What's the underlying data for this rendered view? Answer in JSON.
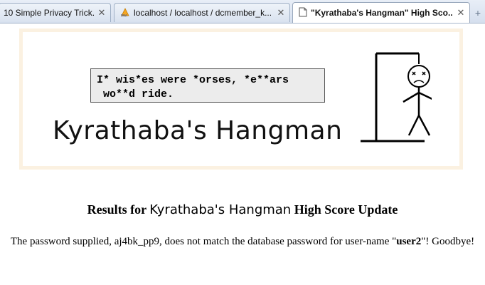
{
  "tabs": [
    {
      "label": "10 Simple Privacy Trick...",
      "active": false,
      "icon": "none"
    },
    {
      "label": "localhost / localhost / dcmember_k...",
      "active": false,
      "icon": "phpmyadmin-icon"
    },
    {
      "label": "\"Kyrathaba's Hangman\" High Sco...",
      "active": true,
      "icon": "page-icon"
    }
  ],
  "new_tab_symbol": "+",
  "close_symbol": "✕",
  "banner": {
    "puzzle_line1": "I* wis*es were *orses, *e**ars",
    "puzzle_line2": " wo**d ride.",
    "title": "Kyrathaba's Hangman"
  },
  "results": {
    "heading_prefix": "Results for",
    "heading_game": "Kyrathaba's Hangman",
    "heading_suffix": "High Score Update",
    "message_prefix": "The password supplied, aj4bk_pp9, does not match the database password for user-name \"",
    "username": "user2",
    "message_suffix": "\"! Goodbye!"
  },
  "colors": {
    "banner_border": "#fbf1e1",
    "puzzle_bg": "#ececec",
    "tab_strip": "#d5dfee"
  }
}
